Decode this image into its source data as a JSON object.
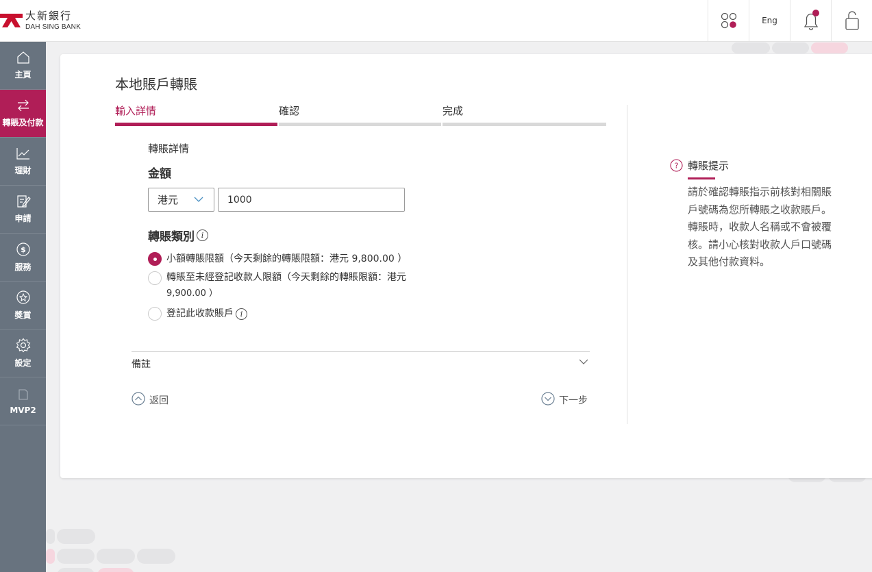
{
  "header": {
    "logo_cn": "大新銀行",
    "logo_en": "DAH SING BANK",
    "lang_label": "Eng",
    "icons": [
      "apps-icon",
      "bell-icon",
      "lock-icon"
    ]
  },
  "sidebar": {
    "items": [
      {
        "label": "主頁",
        "icon": "home-icon",
        "active": false
      },
      {
        "label": "轉賬及付款",
        "icon": "transfer-icon",
        "active": true
      },
      {
        "label": "理財",
        "icon": "chart-icon",
        "active": false
      },
      {
        "label": "申請",
        "icon": "apply-icon",
        "active": false
      },
      {
        "label": "服務",
        "icon": "dollar-icon",
        "active": false
      },
      {
        "label": "獎賞",
        "icon": "star-icon",
        "active": false
      },
      {
        "label": "設定",
        "icon": "gear-icon",
        "active": false
      },
      {
        "label": "MVP2",
        "icon": "document-icon",
        "active": false
      }
    ]
  },
  "page": {
    "title": "本地賬戶轉賬",
    "steps": [
      {
        "label": "輸入詳情",
        "active": true
      },
      {
        "label": "確認",
        "active": false
      },
      {
        "label": "完成",
        "active": false
      }
    ],
    "section_title": "轉賬詳情",
    "amount_label": "金額",
    "currency": "港元",
    "amount_value": "1000",
    "type_label": "轉賬類別",
    "options": [
      {
        "line1": "小額轉賬限額（今天剩餘的轉賬限額：港元 9,800.00 ）",
        "line2": "",
        "selected": true
      },
      {
        "line1": "轉賬至未經登記收款人限額（今天剩餘的轉賬限額：港元",
        "line2": "9,900.00 ）",
        "selected": false
      },
      {
        "line1": "登記此收款賬戶",
        "line2": "",
        "selected": false
      }
    ],
    "remarks_label": "備註",
    "back_label": "返回",
    "next_label": "下一步"
  },
  "tip": {
    "title": "轉賬提示",
    "text": "請於確認轉賬指示前核對相關賬戶號碼為您所轉賬之收款賬戶。轉賬時，收款人名稱或不會被覆核。請小心核對收款人戶口號碼及其他付款資料。"
  },
  "colors": {
    "brand": "#b01e57",
    "sidebar": "#68737f"
  }
}
